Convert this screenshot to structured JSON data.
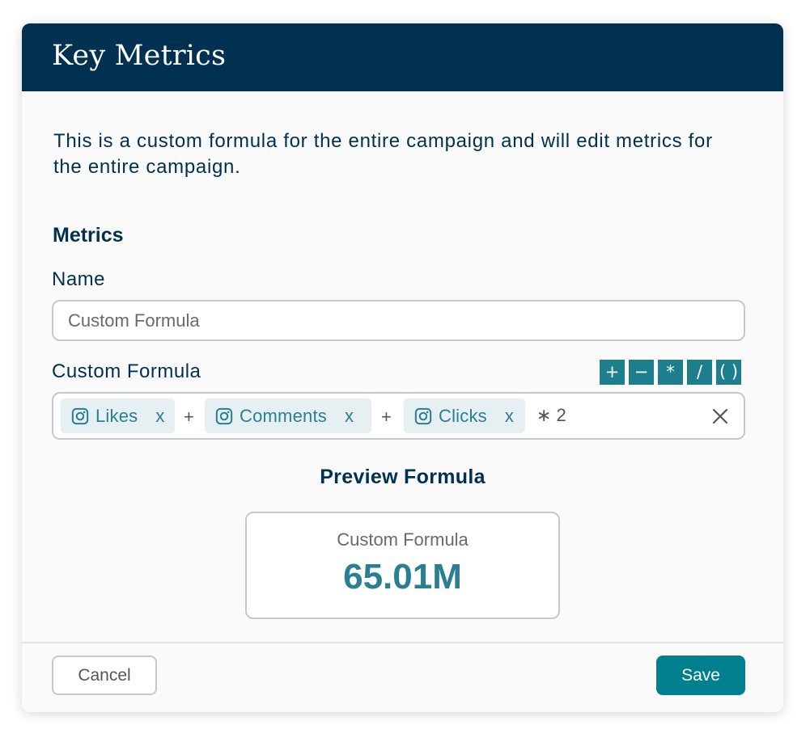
{
  "header": {
    "title": "Key Metrics"
  },
  "description": "This is a custom formula for the entire campaign and will edit metrics for the entire campaign.",
  "metrics": {
    "section_title": "Metrics",
    "name_label": "Name",
    "name_value": "Custom Formula",
    "formula_label": "Custom Formula",
    "operators": [
      "+",
      "−",
      "*",
      "/",
      "( )"
    ],
    "formula_tokens": {
      "chips": [
        {
          "icon": "instagram-icon",
          "label": "Likes",
          "remove": "x"
        },
        {
          "icon": "instagram-icon",
          "label": "Comments",
          "remove": "x"
        },
        {
          "icon": "instagram-icon",
          "label": "Clicks",
          "remove": "x"
        }
      ],
      "join_operator": "+",
      "multiplier": "∗ 2"
    }
  },
  "preview": {
    "title": "Preview Formula",
    "card_label": "Custom Formula",
    "card_value": "65.01M"
  },
  "footer": {
    "cancel_label": "Cancel",
    "save_label": "Save"
  },
  "colors": {
    "header_bg": "#003150",
    "accent": "#00808f",
    "chip_bg": "#e6f0f2",
    "chip_text": "#2a7f92"
  }
}
